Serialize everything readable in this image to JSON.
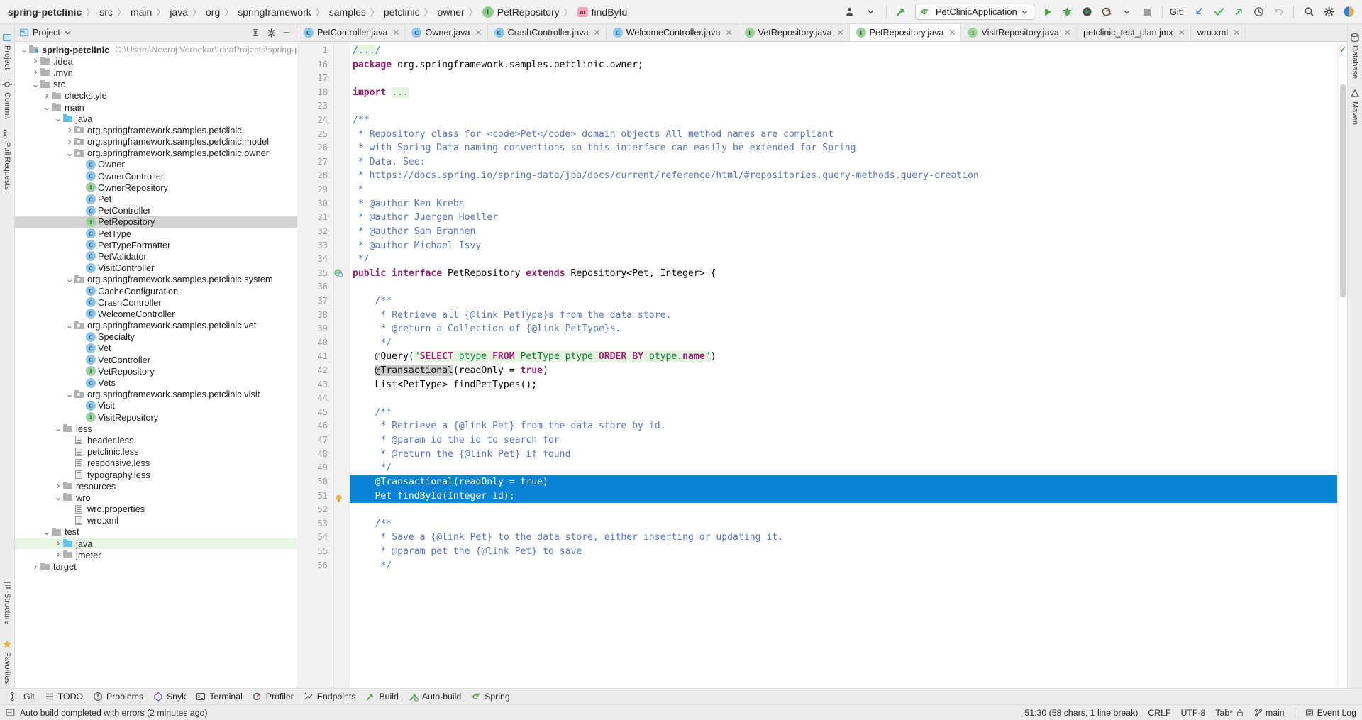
{
  "breadcrumb": {
    "items": [
      {
        "label": "spring-petclinic",
        "kind": "project"
      },
      {
        "label": "src",
        "kind": "dir"
      },
      {
        "label": "main",
        "kind": "dir"
      },
      {
        "label": "java",
        "kind": "dir"
      },
      {
        "label": "org",
        "kind": "dir"
      },
      {
        "label": "springframework",
        "kind": "dir"
      },
      {
        "label": "samples",
        "kind": "dir"
      },
      {
        "label": "petclinic",
        "kind": "dir"
      },
      {
        "label": "owner",
        "kind": "dir"
      },
      {
        "label": "PetRepository",
        "kind": "interface"
      },
      {
        "label": "findById",
        "kind": "method"
      }
    ]
  },
  "toolbar": {
    "run_config": "PetClinicApplication",
    "git_label": "Git:",
    "icons": [
      "user-avatar-icon",
      "chevron-down-icon",
      "build-hammer-icon",
      "run-icon",
      "debug-icon",
      "run-coverage-icon",
      "profiler-icon",
      "stop-icon",
      "git-update-icon",
      "git-commit-icon",
      "git-push-icon",
      "history-icon",
      "rollback-icon",
      "search-everywhere-icon",
      "settings-gear-icon",
      "ide-assistant-icon"
    ]
  },
  "left_rail": [
    {
      "label": "Project",
      "icon": "project-icon"
    },
    {
      "label": "Commit",
      "icon": "commit-icon"
    },
    {
      "label": "Pull Requests",
      "icon": "pull-requests-icon"
    },
    {
      "label": "Structure",
      "icon": "structure-icon"
    },
    {
      "label": "Favorites",
      "icon": "star-icon"
    }
  ],
  "right_rail": [
    {
      "label": "Database",
      "icon": "database-icon"
    },
    {
      "label": "Maven",
      "icon": "maven-icon"
    }
  ],
  "project_panel": {
    "title": "Project",
    "header_icons": [
      "collapse-all-icon",
      "settings-gear-icon",
      "hide-icon"
    ],
    "tree": [
      {
        "depth": 0,
        "twist": "v",
        "glyph": "proj",
        "label": "spring-petclinic",
        "bold": true,
        "path": "C:\\Users\\Neeraj Vernekar\\IdeaProjects\\spring-petclinic"
      },
      {
        "depth": 1,
        "twist": ">",
        "glyph": "folder",
        "label": ".idea"
      },
      {
        "depth": 1,
        "twist": ">",
        "glyph": "folder",
        "label": ".mvn"
      },
      {
        "depth": 1,
        "twist": "v",
        "glyph": "folder",
        "label": "src"
      },
      {
        "depth": 2,
        "twist": ">",
        "glyph": "folder",
        "label": "checkstyle"
      },
      {
        "depth": 2,
        "twist": "v",
        "glyph": "folder",
        "label": "main"
      },
      {
        "depth": 3,
        "twist": "v",
        "glyph": "folder-blue",
        "label": "java"
      },
      {
        "depth": 4,
        "twist": ">",
        "glyph": "pkg",
        "label": "org.springframework.samples.petclinic"
      },
      {
        "depth": 4,
        "twist": ">",
        "glyph": "pkg",
        "label": "org.springframework.samples.petclinic.model"
      },
      {
        "depth": 4,
        "twist": "v",
        "glyph": "pkg",
        "label": "org.springframework.samples.petclinic.owner"
      },
      {
        "depth": 5,
        "twist": "",
        "glyph": "class",
        "label": "Owner"
      },
      {
        "depth": 5,
        "twist": "",
        "glyph": "class",
        "label": "OwnerController"
      },
      {
        "depth": 5,
        "twist": "",
        "glyph": "iface",
        "label": "OwnerRepository"
      },
      {
        "depth": 5,
        "twist": "",
        "glyph": "class",
        "label": "Pet"
      },
      {
        "depth": 5,
        "twist": "",
        "glyph": "class",
        "label": "PetController"
      },
      {
        "depth": 5,
        "twist": "",
        "glyph": "iface",
        "label": "PetRepository",
        "selected": true
      },
      {
        "depth": 5,
        "twist": "",
        "glyph": "class",
        "label": "PetType"
      },
      {
        "depth": 5,
        "twist": "",
        "glyph": "class",
        "label": "PetTypeFormatter"
      },
      {
        "depth": 5,
        "twist": "",
        "glyph": "class",
        "label": "PetValidator"
      },
      {
        "depth": 5,
        "twist": "",
        "glyph": "class",
        "label": "VisitController"
      },
      {
        "depth": 4,
        "twist": "v",
        "glyph": "pkg",
        "label": "org.springframework.samples.petclinic.system"
      },
      {
        "depth": 5,
        "twist": "",
        "glyph": "class",
        "label": "CacheConfiguration"
      },
      {
        "depth": 5,
        "twist": "",
        "glyph": "class",
        "label": "CrashController"
      },
      {
        "depth": 5,
        "twist": "",
        "glyph": "class",
        "label": "WelcomeController"
      },
      {
        "depth": 4,
        "twist": "v",
        "glyph": "pkg",
        "label": "org.springframework.samples.petclinic.vet"
      },
      {
        "depth": 5,
        "twist": "",
        "glyph": "class",
        "label": "Specialty"
      },
      {
        "depth": 5,
        "twist": "",
        "glyph": "class",
        "label": "Vet"
      },
      {
        "depth": 5,
        "twist": "",
        "glyph": "class",
        "label": "VetController"
      },
      {
        "depth": 5,
        "twist": "",
        "glyph": "iface",
        "label": "VetRepository"
      },
      {
        "depth": 5,
        "twist": "",
        "glyph": "class",
        "label": "Vets"
      },
      {
        "depth": 4,
        "twist": "v",
        "glyph": "pkg",
        "label": "org.springframework.samples.petclinic.visit"
      },
      {
        "depth": 5,
        "twist": "",
        "glyph": "class",
        "label": "Visit"
      },
      {
        "depth": 5,
        "twist": "",
        "glyph": "iface",
        "label": "VisitRepository"
      },
      {
        "depth": 3,
        "twist": "v",
        "glyph": "folder",
        "label": "less"
      },
      {
        "depth": 4,
        "twist": "",
        "glyph": "file",
        "label": "header.less"
      },
      {
        "depth": 4,
        "twist": "",
        "glyph": "file",
        "label": "petclinic.less"
      },
      {
        "depth": 4,
        "twist": "",
        "glyph": "file",
        "label": "responsive.less"
      },
      {
        "depth": 4,
        "twist": "",
        "glyph": "file",
        "label": "typography.less"
      },
      {
        "depth": 3,
        "twist": ">",
        "glyph": "folder",
        "label": "resources"
      },
      {
        "depth": 3,
        "twist": "v",
        "glyph": "folder",
        "label": "wro"
      },
      {
        "depth": 4,
        "twist": "",
        "glyph": "file",
        "label": "wro.properties"
      },
      {
        "depth": 4,
        "twist": "",
        "glyph": "file",
        "label": "wro.xml"
      },
      {
        "depth": 2,
        "twist": "v",
        "glyph": "folder",
        "label": "test"
      },
      {
        "depth": 3,
        "twist": ">",
        "glyph": "folder-blue",
        "label": "java",
        "green": true
      },
      {
        "depth": 3,
        "twist": ">",
        "glyph": "folder",
        "label": "jmeter"
      },
      {
        "depth": 1,
        "twist": ">",
        "glyph": "folder",
        "label": "target"
      }
    ]
  },
  "editor_tabs": [
    {
      "label": "PetController.java",
      "kind": "class",
      "active": false
    },
    {
      "label": "Owner.java",
      "kind": "class",
      "active": false
    },
    {
      "label": "CrashController.java",
      "kind": "class",
      "active": false
    },
    {
      "label": "WelcomeController.java",
      "kind": "class",
      "active": false
    },
    {
      "label": "VetRepository.java",
      "kind": "interface",
      "active": false
    },
    {
      "label": "PetRepository.java",
      "kind": "interface",
      "active": true
    },
    {
      "label": "VisitRepository.java",
      "kind": "interface",
      "active": false
    },
    {
      "label": "petclinic_test_plan.jmx",
      "kind": "file",
      "active": false
    },
    {
      "label": "wro.xml",
      "kind": "file",
      "active": false
    }
  ],
  "code": {
    "lines": [
      {
        "n": "1",
        "fold": "+",
        "html": "<span class=\"cmt hl-green\">/...</span><span class=\"cmt\">/</span>"
      },
      {
        "n": "16",
        "html": "<span class=\"kw\">package</span> org.springframework.samples.petclinic.owner;"
      },
      {
        "n": "17",
        "html": ""
      },
      {
        "n": "18",
        "fold": "+",
        "html": "<span class=\"kw\">import</span> <span class=\"hl-green\" style=\"color:#7a7a7a\">...</span>"
      },
      {
        "n": "23",
        "html": ""
      },
      {
        "n": "24",
        "fold": "-",
        "html": "<span class=\"cmt\">/**</span>"
      },
      {
        "n": "25",
        "html": "<span class=\"cmt\"> * Repository class for &lt;code&gt;Pet&lt;/code&gt; domain objects All method names are compliant</span>"
      },
      {
        "n": "26",
        "html": "<span class=\"cmt\"> * with Spring Data naming conventions so this interface can easily be extended for Spring</span>"
      },
      {
        "n": "27",
        "html": "<span class=\"cmt\"> * Data. See:</span>"
      },
      {
        "n": "28",
        "html": "<span class=\"cmt\"> * https://docs.spring.io/spring-data/jpa/docs/current/reference/html/#repositories.query-methods.query-creation</span>"
      },
      {
        "n": "29",
        "html": "<span class=\"cmt\"> *</span>"
      },
      {
        "n": "30",
        "html": "<span class=\"cmt\"> * @author Ken Krebs</span>"
      },
      {
        "n": "31",
        "html": "<span class=\"cmt\"> * @author Juergen Hoeller</span>"
      },
      {
        "n": "32",
        "html": "<span class=\"cmt\"> * @author Sam Brannen</span>"
      },
      {
        "n": "33",
        "html": "<span class=\"cmt\"> * @author Michael Isvy</span>"
      },
      {
        "n": "34",
        "fold": "e",
        "html": "<span class=\"cmt\"> */</span>"
      },
      {
        "n": "35",
        "icon": "impl-gutter-icon",
        "html": "<span class=\"kw\">public interface</span> PetRepository <span class=\"kw\">extends</span> Repository&lt;Pet, Integer&gt; {"
      },
      {
        "n": "36",
        "html": ""
      },
      {
        "n": "37",
        "fold": "-",
        "html": "    <span class=\"cmt\">/**</span>"
      },
      {
        "n": "38",
        "html": "     <span class=\"cmt\">* Retrieve all {@link PetType}s from the data store.</span>"
      },
      {
        "n": "39",
        "html": "     <span class=\"cmt\">* @return a Collection of {@link PetType}s.</span>"
      },
      {
        "n": "40",
        "fold": "e",
        "html": "     <span class=\"cmt\">*/</span>"
      },
      {
        "n": "41",
        "fold": "-",
        "html": "    @Query(<span class=\"hl-green\"><span class=\"str\">\"</span><span class=\"sqlkw\">SELECT</span><span class=\"str\"> ptype </span><span class=\"sqlkw\">FROM</span><span class=\"str\"> PetType ptype </span><span class=\"sqlkw\">ORDER BY</span><span class=\"str\"> ptype.</span><span class=\"sqlkw\">name</span><span class=\"str\">\"</span></span>)"
      },
      {
        "n": "42",
        "fold": "e",
        "html": "    <span class=\"hl-gray\">@Transactional</span>(readOnly = <span class=\"kw\">true</span>)"
      },
      {
        "n": "43",
        "html": "    List&lt;PetType&gt; findPetTypes();"
      },
      {
        "n": "44",
        "html": ""
      },
      {
        "n": "45",
        "fold": "-",
        "html": "    <span class=\"cmt\">/**</span>"
      },
      {
        "n": "46",
        "html": "     <span class=\"cmt\">* Retrieve a {@link Pet} from the data store by id.</span>"
      },
      {
        "n": "47",
        "html": "     <span class=\"cmt\">* @param id the id to search for</span>"
      },
      {
        "n": "48",
        "html": "     <span class=\"cmt\">* @return the {@link Pet} if found</span>"
      },
      {
        "n": "49",
        "fold": "e",
        "html": "     <span class=\"cmt\">*/</span>"
      },
      {
        "n": "50",
        "selected": true,
        "html": "    <span class=\"seltext\">@Transactional(readOnly = true)</span>"
      },
      {
        "n": "51",
        "selected": true,
        "icon": "warning-bulb-icon",
        "html": "    <span class=\"seltext\">Pet findById(Integer id);</span>"
      },
      {
        "n": "52",
        "html": ""
      },
      {
        "n": "53",
        "fold": "-",
        "html": "    <span class=\"cmt\">/**</span>"
      },
      {
        "n": "54",
        "html": "     <span class=\"cmt\">* Save a {@link Pet} to the data store, either inserting or updating it.</span>"
      },
      {
        "n": "55",
        "html": "     <span class=\"cmt\">* @param pet the {@link Pet} to save</span>"
      },
      {
        "n": "56",
        "fold": "e",
        "html": "     <span class=\"cmt\">*/</span>"
      }
    ]
  },
  "bottom_tools": [
    {
      "label": "Git",
      "icon": "git-branch-icon"
    },
    {
      "label": "TODO",
      "icon": "todo-list-icon"
    },
    {
      "label": "Problems",
      "icon": "problems-icon"
    },
    {
      "label": "Snyk",
      "icon": "snyk-icon"
    },
    {
      "label": "Terminal",
      "icon": "terminal-icon"
    },
    {
      "label": "Profiler",
      "icon": "profiler-icon"
    },
    {
      "label": "Endpoints",
      "icon": "endpoints-icon"
    },
    {
      "label": "Build",
      "icon": "build-hammer-icon"
    },
    {
      "label": "Auto-build",
      "icon": "auto-build-icon"
    },
    {
      "label": "Spring",
      "icon": "spring-leaf-icon"
    }
  ],
  "status_bar": {
    "message": "Auto build completed with errors (2 minutes ago)",
    "caret": "51:30 (58 chars, 1 line break)",
    "line_separator": "CRLF",
    "encoding": "UTF-8",
    "indent": "Tab*",
    "branch": "main",
    "event_log": "Event Log"
  },
  "colors": {
    "accent_blue": "#0b84d6",
    "keyword": "#9b1f6e",
    "comment": "#5a76c8",
    "string": "#0b7d33",
    "green_run": "#3c9e3c",
    "panel_bg": "#ececec"
  }
}
